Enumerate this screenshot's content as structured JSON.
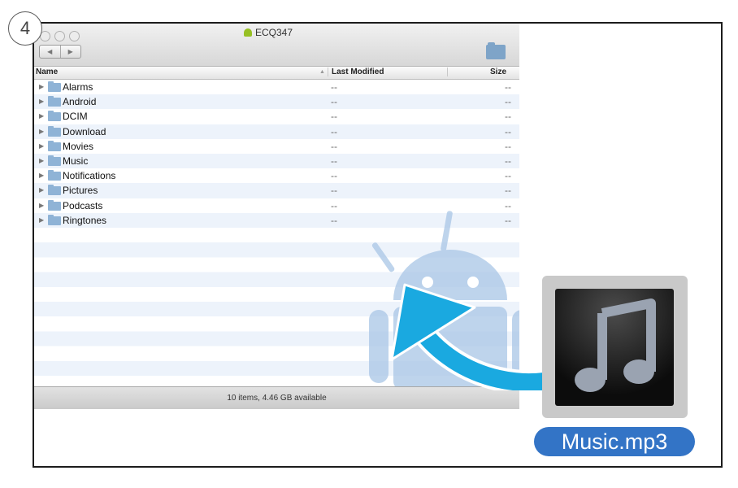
{
  "step": {
    "number": "4"
  },
  "window": {
    "title": "ECQ347"
  },
  "toolbar": {
    "back_glyph": "◀",
    "forward_glyph": "▶"
  },
  "columns": {
    "name": "Name",
    "last_modified": "Last Modified",
    "size": "Size"
  },
  "files": [
    {
      "name": "Alarms",
      "modified": "--",
      "size": "--"
    },
    {
      "name": "Android",
      "modified": "--",
      "size": "--"
    },
    {
      "name": "DCIM",
      "modified": "--",
      "size": "--"
    },
    {
      "name": "Download",
      "modified": "--",
      "size": "--"
    },
    {
      "name": "Movies",
      "modified": "--",
      "size": "--"
    },
    {
      "name": "Music",
      "modified": "--",
      "size": "--"
    },
    {
      "name": "Notifications",
      "modified": "--",
      "size": "--"
    },
    {
      "name": "Pictures",
      "modified": "--",
      "size": "--"
    },
    {
      "name": "Podcasts",
      "modified": "--",
      "size": "--"
    },
    {
      "name": "Ringtones",
      "modified": "--",
      "size": "--"
    }
  ],
  "status": {
    "text": "10 items, 4.46 GB available"
  },
  "drag_item": {
    "filename": "Music.mp3",
    "icon": "music-note-icon"
  },
  "colors": {
    "arrow": "#1aa9e0",
    "label_bg": "#3374c6",
    "watermark": "#a9c6e6",
    "folder": "#8fb3d6"
  }
}
